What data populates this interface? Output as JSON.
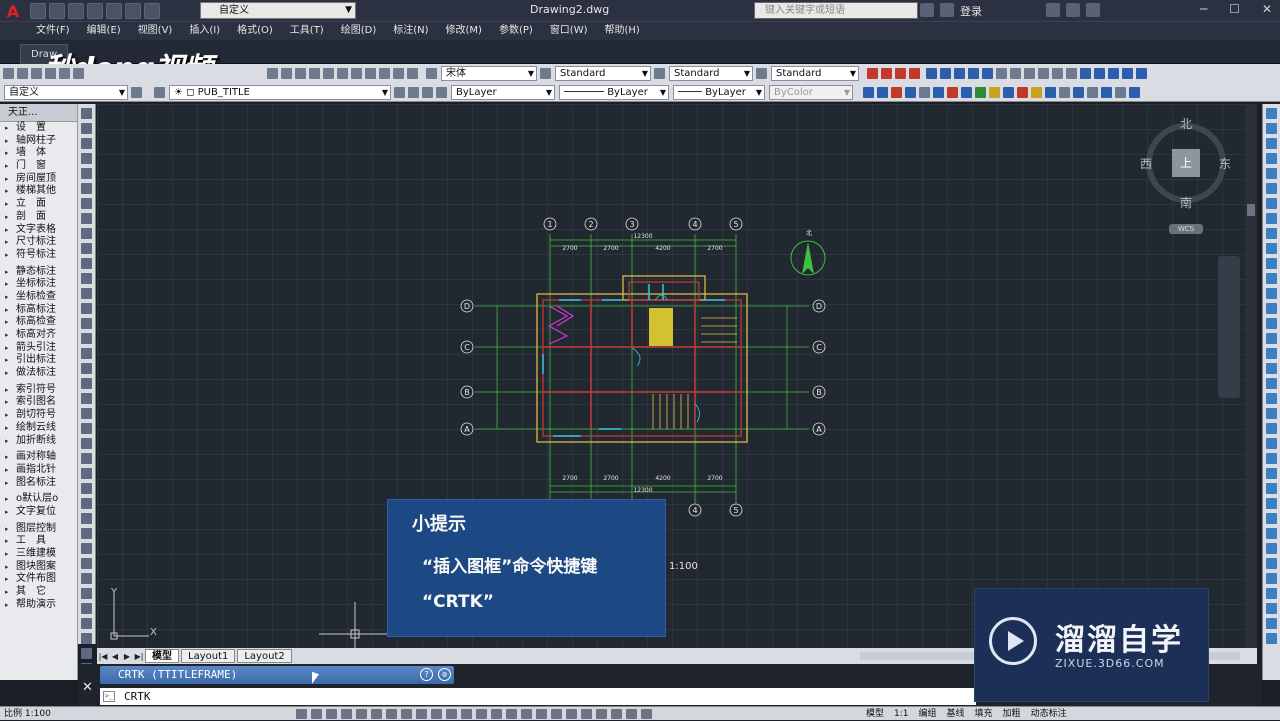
{
  "titlebar": {
    "workspace": "自定义",
    "document_title": "Drawing2.dwg",
    "search_placeholder": "键入关键字或短语",
    "login_label": "登录"
  },
  "menu": [
    "文件(F)",
    "编辑(E)",
    "视图(V)",
    "插入(I)",
    "格式(O)",
    "工具(T)",
    "绘图(D)",
    "标注(N)",
    "修改(M)",
    "参数(P)",
    "窗口(W)",
    "帮助(H)"
  ],
  "doc_tab": "Draw",
  "watermark": "秒dong视频",
  "toolbar": {
    "font": "宋体",
    "text_style": "Standard",
    "dim_style": "Standard",
    "table_style": "Standard",
    "workspace2": "自定义",
    "layer": "PUB_TITLE",
    "color": "ByLayer",
    "linetype": "ByLayer",
    "lineweight": "ByLayer",
    "plotstyle": "ByColor"
  },
  "left_panel": {
    "header": "天正...",
    "items": [
      "设　置",
      "轴网柱子",
      "墙　体",
      "门　窗",
      "房间屋顶",
      "楼梯其他",
      "立　面",
      "剖　面",
      "文字表格",
      "尺寸标注",
      "符号标注",
      "静态标注",
      "坐标标注",
      "坐标检查",
      "标高标注",
      "标高检查",
      "标高对齐",
      "箭头引注",
      "引出标注",
      "做法标注",
      "索引符号",
      "索引图名",
      "剖切符号",
      "绘制云线",
      "加折断线",
      "画对称轴",
      "画指北针",
      "图名标注",
      "o默认层o",
      "文字复位",
      "图层控制",
      "工　具",
      "三维建模",
      "图块图案",
      "文件布图",
      "其　它",
      "帮助演示"
    ]
  },
  "viewcube": {
    "north": "北",
    "south": "南",
    "east": "东",
    "west": "西",
    "top": "上",
    "wcs": "WCS"
  },
  "drawing": {
    "axis_top": [
      "1",
      "2",
      "3",
      "4",
      "5"
    ],
    "axis_side": [
      "D",
      "C",
      "B",
      "A"
    ],
    "dims_top": [
      "2700",
      "2700",
      "4200",
      "2700"
    ],
    "total": "12300",
    "scale_label": "1:100",
    "north_label": "北"
  },
  "layout_tabs": [
    "模型",
    "Layout1",
    "Layout2"
  ],
  "command": {
    "history": "CRTK (TTITLEFRAME)",
    "input": "CRTK"
  },
  "tip": {
    "title": "小提示",
    "line1": "“插入图框”命令快捷键",
    "line2": "“CRTK”"
  },
  "brand": {
    "name": "溜溜自学",
    "url": "ZIXUE.3D66.COM"
  },
  "status": {
    "scale": "比例 1:100",
    "right_items": [
      "模型",
      "1:1",
      "编组",
      "基线",
      "填充",
      "加粗",
      "动态标注"
    ]
  }
}
